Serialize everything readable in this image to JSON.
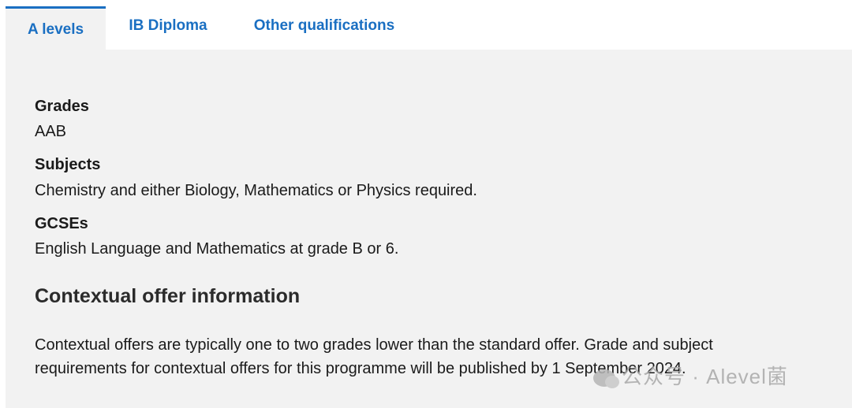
{
  "tabs": {
    "a_levels": "A levels",
    "ib_diploma": "IB Diploma",
    "other_qualifications": "Other qualifications"
  },
  "requirements": {
    "grades_label": "Grades",
    "grades_value": "AAB",
    "subjects_label": "Subjects",
    "subjects_value": "Chemistry and either Biology, Mathematics or Physics required.",
    "gcses_label": "GCSEs",
    "gcses_value": "English Language and Mathematics at grade B or 6."
  },
  "contextual": {
    "heading": "Contextual offer information",
    "line1": "Contextual offers are typically one to two grades lower than the standard offer. Grade and subject",
    "line2": "requirements for contextual offers for this programme will be published by 1 September 2024."
  },
  "watermark": {
    "text": "公众号 · Alevel菌",
    "icon": "wechat-icon"
  },
  "colors": {
    "accent": "#1a6fc2",
    "panel_background": "#f2f2f2"
  }
}
